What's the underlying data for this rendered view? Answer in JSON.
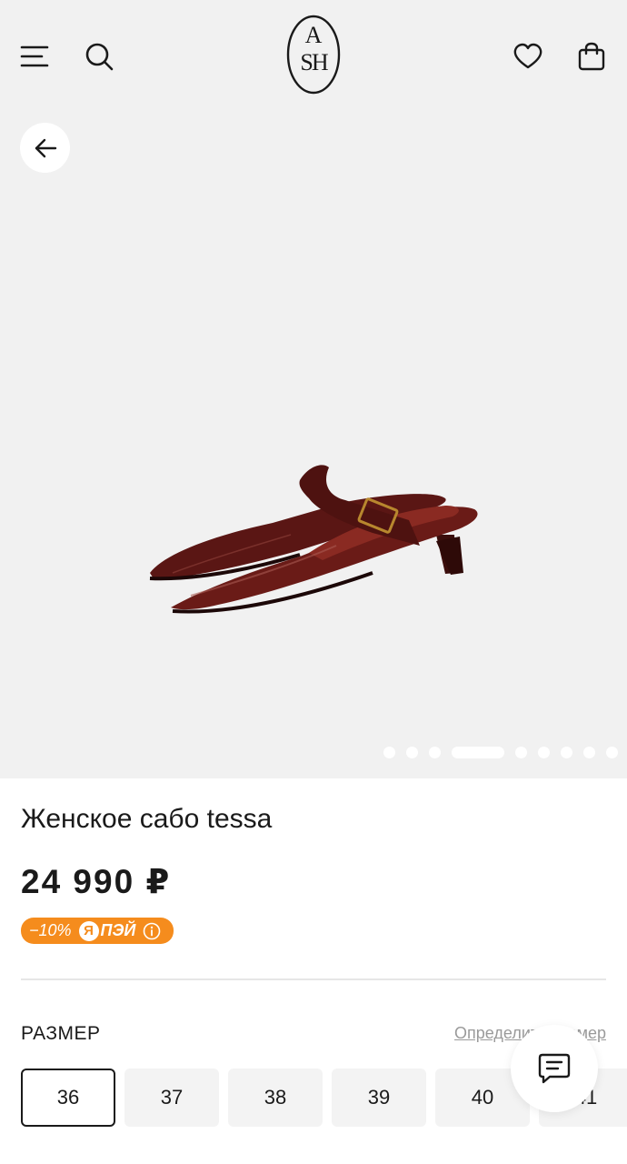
{
  "header": {
    "logo_top": "A",
    "logo_bottom": "SH",
    "icons": [
      "menu-icon",
      "search-icon",
      "heart-icon",
      "bag-icon"
    ]
  },
  "gallery": {
    "slide_count": 9,
    "active_slide": 4,
    "background": "#f1f1f1"
  },
  "product": {
    "title": "Женское сабо tessa",
    "price": "24 990 ₽",
    "promo": {
      "discount": "−10%",
      "ya_letter": "Я",
      "pay_label": "ПЭЙ",
      "color": "#f58c1d"
    }
  },
  "size_section": {
    "label": "РАЗМЕР",
    "guide_link": "Определить размер",
    "sizes": [
      "36",
      "37",
      "38",
      "39",
      "40",
      "41"
    ],
    "selected": "36"
  }
}
